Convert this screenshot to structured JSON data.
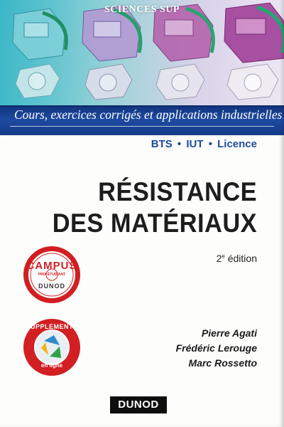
{
  "cover": {
    "series": "SCIENCES SUP",
    "tagline": "Cours, exercices corrigés et applications industrielles",
    "levels": [
      "BTS",
      "IUT",
      "Licence"
    ],
    "level_separator": "•",
    "title_line1": "RÉSISTANCE",
    "title_line2": "DES MATÉRIAUX",
    "edition_number": "2",
    "edition_suffix": "e",
    "edition_word": " édition",
    "authors": [
      "Pierre Agati",
      "Frédéric Lerouge",
      "Marc Rossetto"
    ],
    "publisher": "DUNOD"
  },
  "badges": {
    "campus": {
      "word": "CAMPUS",
      "small": "PRIX ÉTUDIANT",
      "brand": "DUNOD"
    },
    "supplements": {
      "word": "SUPPLEMENTS",
      "sub": "en ligne"
    }
  },
  "colors": {
    "band_blue": "#1d4aa0",
    "levels_blue": "#1c4b9c",
    "badge_red": "#d11f22",
    "illustration_teal": "#3bb7c7",
    "illustration_purple": "#a4489c"
  }
}
